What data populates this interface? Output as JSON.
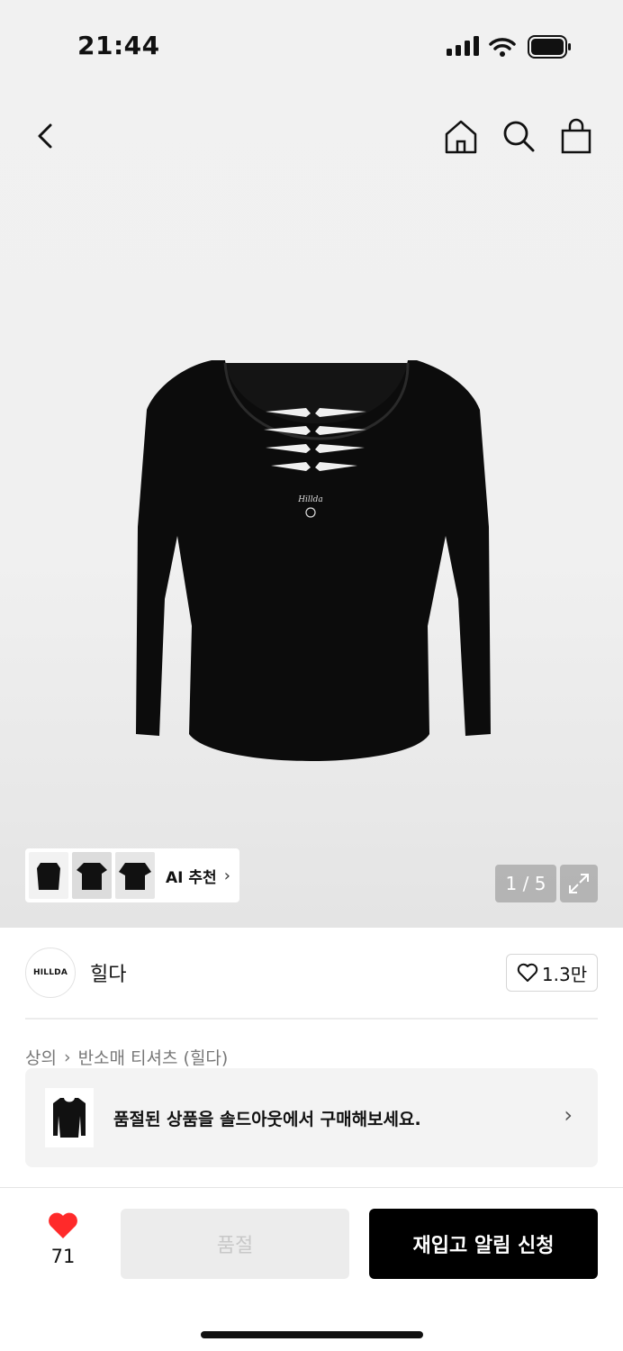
{
  "status_bar": {
    "time": "21:44"
  },
  "gallery": {
    "pager": "1 / 5",
    "ai_recommend_label": "AI 추천"
  },
  "brand": {
    "logo_text": "HILLDA",
    "name": "힐다",
    "likes": "1.3만"
  },
  "breadcrumb": {
    "category": "상의",
    "subcategory": "반소매 티셔츠 (힐다)"
  },
  "soldout_banner": {
    "message": "품절된 상품을 솔드아웃에서 구매해보세요."
  },
  "bottom_bar": {
    "like_count": "71",
    "soldout_label": "품절",
    "restock_label": "재입고 알림 신청"
  },
  "colors": {
    "accent_red": "#ff2a2a",
    "primary_black": "#000000"
  }
}
